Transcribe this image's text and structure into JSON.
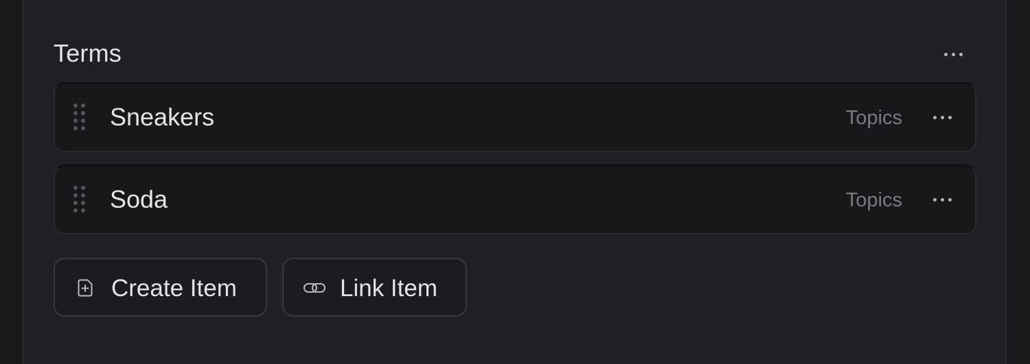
{
  "section": {
    "title": "Terms"
  },
  "items": [
    {
      "label": "Sneakers",
      "tag": "Topics"
    },
    {
      "label": "Soda",
      "tag": "Topics"
    }
  ],
  "actions": {
    "create_label": "Create Item",
    "link_label": "Link Item"
  },
  "icons": {
    "header_more": "more-horizontal-icon",
    "row_more": "more-horizontal-icon",
    "drag": "drag-handle-icon",
    "create": "plus-square-icon",
    "link": "link-icon"
  },
  "colors": {
    "background": "#19191c",
    "panel": "#202024",
    "row": "#18181b",
    "text": "#e5e5e8",
    "muted_text": "#7a7a80"
  }
}
